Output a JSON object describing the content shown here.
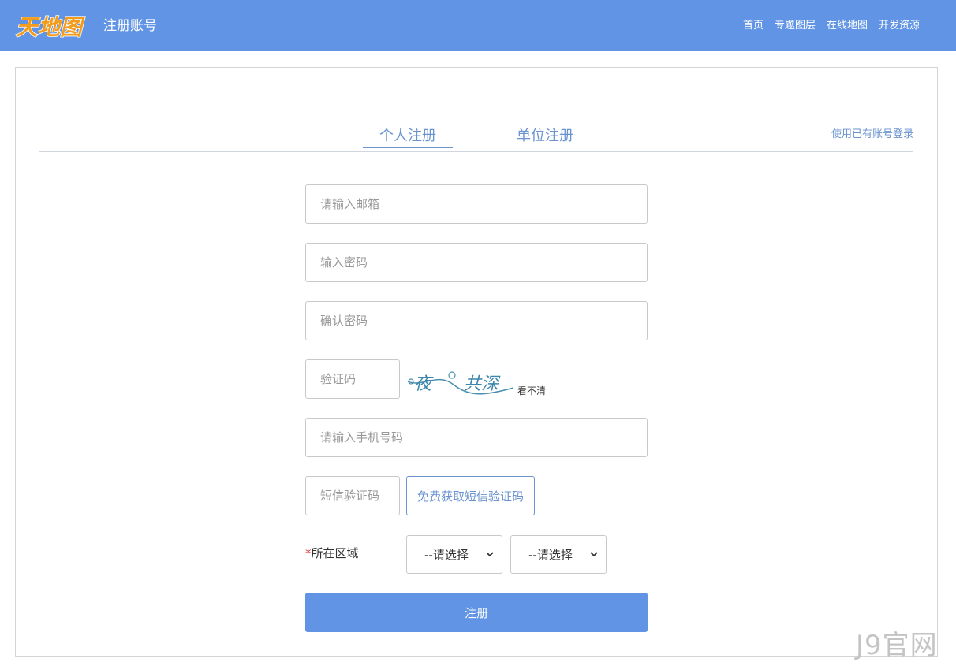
{
  "header": {
    "logo_text": "天地图",
    "title": "注册账号",
    "nav": [
      "首页",
      "专题图层",
      "在线地图",
      "开发资源"
    ]
  },
  "tabs": {
    "personal": "个人注册",
    "unit": "单位注册"
  },
  "login_link": "使用已有账号登录",
  "form": {
    "email_placeholder": "请输入邮箱",
    "password_placeholder": "输入密码",
    "confirm_placeholder": "确认密码",
    "captcha_placeholder": "验证码",
    "captcha_text": "夜 共深",
    "captcha_refresh": "看不清",
    "phone_placeholder": "请输入手机号码",
    "sms_placeholder": "短信验证码",
    "sms_button": "免费获取短信验证码",
    "region_required": "*",
    "region_label": "所在区域",
    "province_select": "--请选择",
    "city_select": "--请选择",
    "submit": "注册"
  },
  "watermark": "J9官网",
  "colors": {
    "header_bg": "#6194e4",
    "accent": "#6a93cf",
    "logo": "#f39c1b"
  }
}
